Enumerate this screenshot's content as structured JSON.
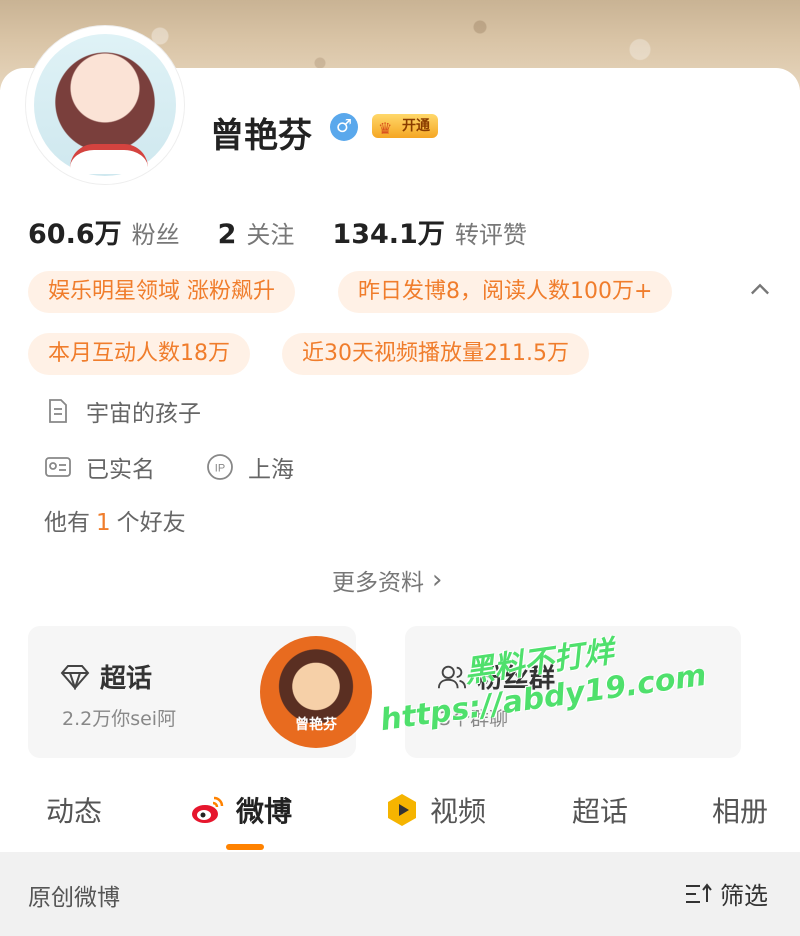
{
  "profile": {
    "name": "曾艳芬",
    "gender_symbol": "♂",
    "vip_label": "开通"
  },
  "stats": [
    {
      "value": "60.6万",
      "label": "粉丝"
    },
    {
      "value": "2",
      "label": "关注"
    },
    {
      "value": "134.1万",
      "label": "转评赞"
    }
  ],
  "tags": [
    "娱乐明星领域 涨粉飙升",
    "昨日发博8，阅读人数100万+",
    "本月互动人数18万",
    "近30天视频播放量211.5万"
  ],
  "info": {
    "bio": "宇宙的孩子",
    "verified": "已实名",
    "ip_label": "IP",
    "location": "上海",
    "friends_prefix": "他有",
    "friends_count": "1",
    "friends_suffix": "个好友",
    "more_label": "更多资料",
    "more_chevron": "›"
  },
  "panels": {
    "supertopic": {
      "title": "超话",
      "subtitle": "2.2万你sei阿",
      "thumb_label": "曾艳芬"
    },
    "fangroup": {
      "title": "粉丝群",
      "subtitle": "3个群聊"
    }
  },
  "watermark": {
    "line1": "黑料不打烊",
    "line2": "https://abdy19.com"
  },
  "tabs": [
    {
      "label": "动态"
    },
    {
      "label": "微博"
    },
    {
      "label": "视频"
    },
    {
      "label": "超话"
    },
    {
      "label": "相册"
    }
  ],
  "filter": {
    "title": "原创微博",
    "button": "筛选"
  },
  "colors": {
    "accent": "#ff8200",
    "tag_bg": "#fff1e6",
    "tag_text": "#f07d2c",
    "gender": "#5aa8ec"
  }
}
